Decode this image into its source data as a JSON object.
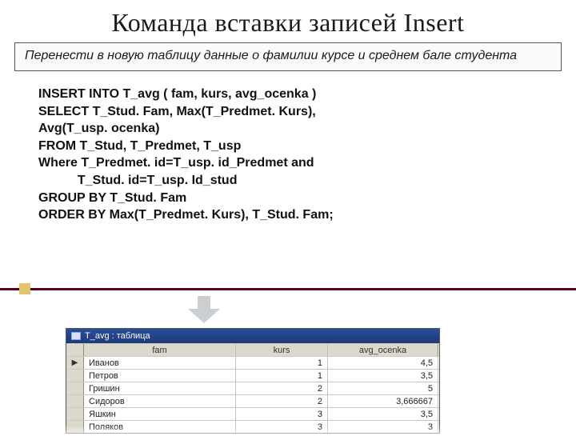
{
  "title": "Команда вставки записей Insert",
  "task_box": "Перенести в новую таблицу данные о фамилии курсе и среднем бале студента",
  "sql": "INSERT INTO T_avg ( fam, kurs, avg_ocenka )\nSELECT T_Stud. Fam, Max(T_Predmet. Kurs),\nAvg(T_usp. ocenka)\nFROM T_Stud, T_Predmet, T_usp\nWhere T_Predmet. id=T_usp. id_Predmet and\n           T_Stud. id=T_usp. Id_stud\nGROUP BY T_Stud. Fam\nORDER BY Max(T_Predmet. Kurs), T_Stud. Fam;",
  "db": {
    "window_title": "T_avg : таблица",
    "columns": {
      "fam": "fam",
      "kurs": "kurs",
      "avg": "avg_ocenka"
    },
    "rows": [
      {
        "fam": "Иванов",
        "kurs": "1",
        "avg": "4,5"
      },
      {
        "fam": "Петров",
        "kurs": "1",
        "avg": "3,5"
      },
      {
        "fam": "Гришин",
        "kurs": "2",
        "avg": "5"
      },
      {
        "fam": "Сидоров",
        "kurs": "2",
        "avg": "3,666667"
      },
      {
        "fam": "Яшкин",
        "kurs": "3",
        "avg": "3,5"
      },
      {
        "fam": "Поляков",
        "kurs": "3",
        "avg": "3"
      }
    ]
  }
}
